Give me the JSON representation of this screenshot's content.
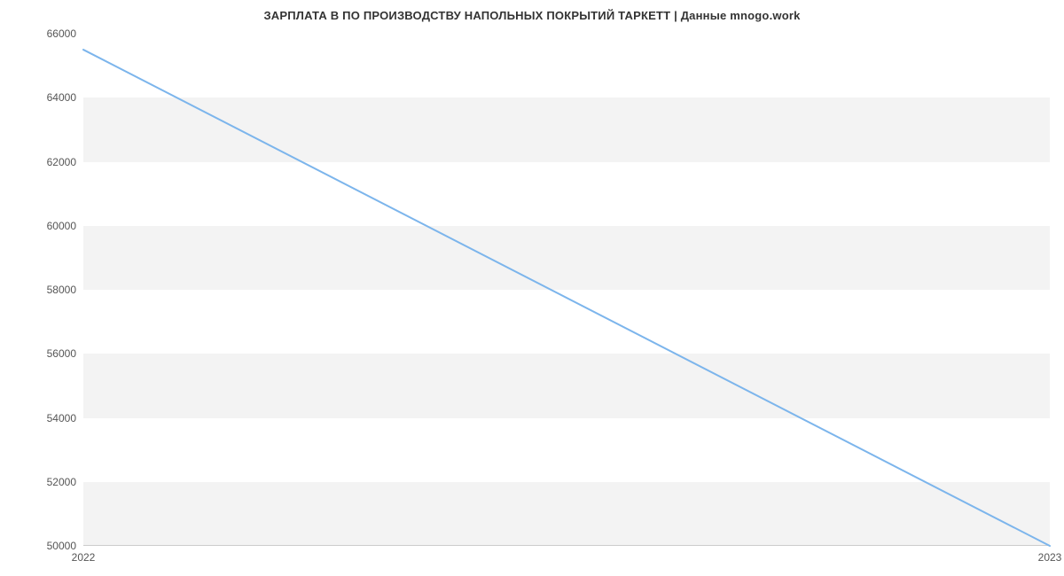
{
  "chart_data": {
    "type": "line",
    "title": "ЗАРПЛАТА В  ПО ПРОИЗВОДСТВУ НАПОЛЬНЫХ ПОКРЫТИЙ ТАРКЕТТ | Данные mnogo.work",
    "xlabel": "",
    "ylabel": "",
    "x": [
      2022,
      2023
    ],
    "values": [
      65500,
      50000
    ],
    "xlim": [
      2022,
      2023
    ],
    "ylim": [
      50000,
      66000
    ],
    "y_ticks": [
      50000,
      52000,
      54000,
      56000,
      58000,
      60000,
      62000,
      64000,
      66000
    ],
    "x_ticks": [
      2022,
      2023
    ],
    "line_color": "#7cb5ec",
    "grid_bands": true
  }
}
